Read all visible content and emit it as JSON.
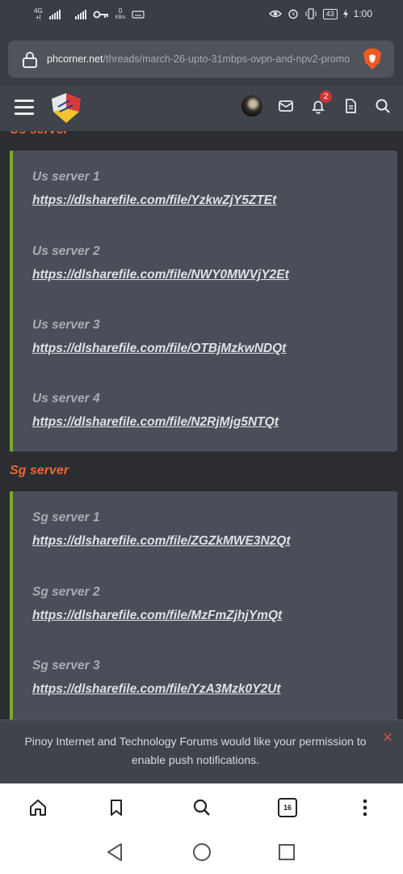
{
  "status_bar": {
    "network_label": "4G",
    "network_sub": "+l",
    "speed_value": "0",
    "speed_unit": "KB/s",
    "battery": "43",
    "time": "1:00"
  },
  "browser": {
    "url_host": "phcorner.net",
    "url_path": "/threads/march-26-upto-31mbps-ovpn-and-npv2-promo",
    "tab_count": "16"
  },
  "header": {
    "notification_count": "2"
  },
  "sections": [
    {
      "title": "Us server",
      "entries": [
        {
          "label": "Us server 1",
          "link": "https://dlsharefile.com/file/YzkwZjY5ZTEt"
        },
        {
          "label": "Us server 2",
          "link": "https://dlsharefile.com/file/NWY0MWVjY2Et"
        },
        {
          "label": "Us server 3",
          "link": "https://dlsharefile.com/file/OTBjMzkwNDQt"
        },
        {
          "label": "Us server 4",
          "link": "https://dlsharefile.com/file/N2RjMjg5NTQt"
        }
      ]
    },
    {
      "title": "Sg server",
      "entries": [
        {
          "label": "Sg server 1",
          "link": "https://dlsharefile.com/file/ZGZkMWE3N2Qt"
        },
        {
          "label": "Sg server 2",
          "link": "https://dlsharefile.com/file/MzFmZjhjYmQt"
        },
        {
          "label": "Sg server 3",
          "link": "https://dlsharefile.com/file/YzA3Mzk0Y2Ut"
        }
      ]
    }
  ],
  "push_prompt": {
    "text": "Pinoy Internet and Technology Forums would like your permission to enable push notifications.",
    "close": "✕"
  },
  "colors": {
    "accent_orange": "#e2683a",
    "quote_bar_green": "#7aaa2f",
    "quote_bg": "#4a4e58",
    "page_bg": "#2b2d31"
  }
}
